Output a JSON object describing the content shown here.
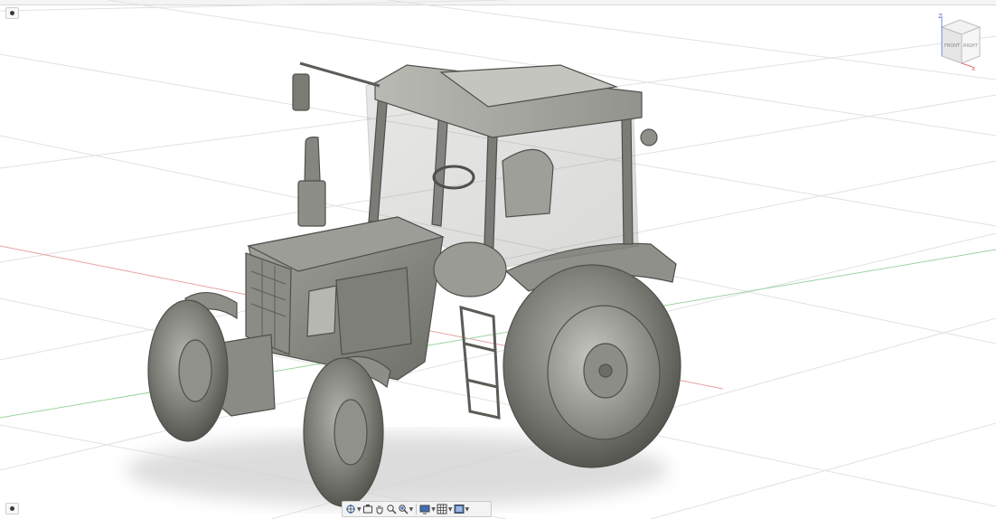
{
  "viewcube": {
    "top_label": "TOP",
    "front_label": "FRONT",
    "right_label": "RIGHT",
    "axis_z": "Z",
    "axis_x": "X"
  },
  "toolbar": {
    "orbit": "orbit-icon",
    "look_at": "look-at-icon",
    "pan": "pan-icon",
    "zoom": "zoom-icon",
    "zoom_window": "zoom-window-icon",
    "display": "display-settings-icon",
    "grid": "grid-icon",
    "viewports": "viewports-icon"
  },
  "colors": {
    "background": "#ffffff",
    "grid": "#dcdcdc",
    "axis_green": "#7cc47c",
    "axis_red": "#e08a8a",
    "model": "#8a8b86"
  }
}
